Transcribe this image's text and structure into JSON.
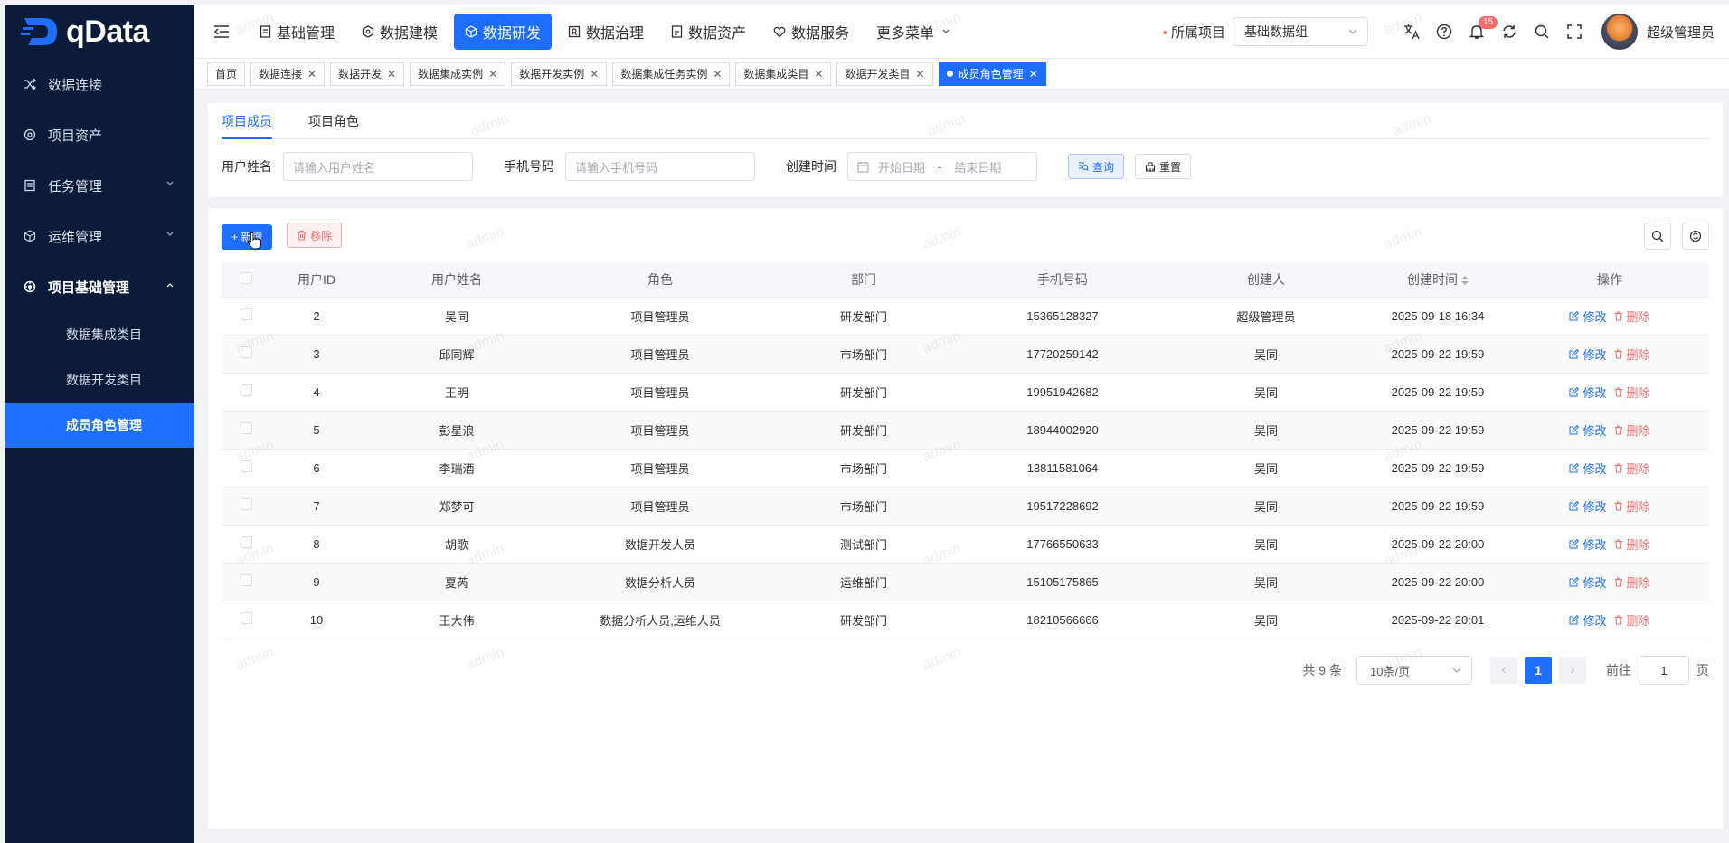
{
  "brand": {
    "name": "qData"
  },
  "sidebar": {
    "items": [
      {
        "label": "数据连接",
        "icon": "shuffle-icon"
      },
      {
        "label": "项目资产",
        "icon": "asset-icon"
      },
      {
        "label": "任务管理",
        "icon": "task-icon",
        "has_children": true
      },
      {
        "label": "运维管理",
        "icon": "cube-icon",
        "has_children": true
      },
      {
        "label": "项目基础管理",
        "icon": "gear-icon",
        "expanded": true
      }
    ],
    "subitems": [
      {
        "label": "数据集成类目"
      },
      {
        "label": "数据开发类目"
      },
      {
        "label": "成员角色管理",
        "active": true
      }
    ]
  },
  "topnav": {
    "items": [
      {
        "label": "基础管理",
        "icon": "doc-icon"
      },
      {
        "label": "数据建模",
        "icon": "model-icon"
      },
      {
        "label": "数据研发",
        "icon": "dev-icon",
        "active": true
      },
      {
        "label": "数据治理",
        "icon": "govern-icon"
      },
      {
        "label": "数据资产",
        "icon": "asset-icon"
      },
      {
        "label": "数据服务",
        "icon": "service-icon"
      },
      {
        "label": "更多菜单",
        "icon": "chevron-down-icon"
      }
    ]
  },
  "header": {
    "project_label": "所属项目",
    "project_value": "基础数据组",
    "notification_count": "15",
    "username": "超级管理员"
  },
  "tags": [
    {
      "label": "首页",
      "closable": false
    },
    {
      "label": "数据连接",
      "closable": true
    },
    {
      "label": "数据开发",
      "closable": true
    },
    {
      "label": "数据集成实例",
      "closable": true
    },
    {
      "label": "数据开发实例",
      "closable": true
    },
    {
      "label": "数据集成任务实例",
      "closable": true
    },
    {
      "label": "数据集成类目",
      "closable": true
    },
    {
      "label": "数据开发类目",
      "closable": true
    },
    {
      "label": "成员角色管理",
      "closable": true,
      "active": true
    }
  ],
  "tabs": [
    {
      "label": "项目成员",
      "active": true
    },
    {
      "label": "项目角色",
      "active": false
    }
  ],
  "search": {
    "username_label": "用户姓名",
    "username_placeholder": "请输入用户姓名",
    "phone_label": "手机号码",
    "phone_placeholder": "请输入手机号码",
    "date_label": "创建时间",
    "date_start_placeholder": "开始日期",
    "date_sep": "-",
    "date_end_placeholder": "结束日期",
    "query_label": "查询",
    "reset_label": "重置"
  },
  "toolbar": {
    "add_label": "+ 新增",
    "remove_label": "移除"
  },
  "table": {
    "columns": [
      "用户ID",
      "用户姓名",
      "角色",
      "部门",
      "手机号码",
      "创建人",
      "创建时间",
      "操作"
    ],
    "edit_label": "修改",
    "delete_label": "删除",
    "rows": [
      {
        "id": "2",
        "name": "吴同",
        "role": "项目管理员",
        "dept": "研发部门",
        "phone": "15365128327",
        "creator": "超级管理员",
        "time": "2025-09-18 16:34"
      },
      {
        "id": "3",
        "name": "邱同辉",
        "role": "项目管理员",
        "dept": "市场部门",
        "phone": "17720259142",
        "creator": "吴同",
        "time": "2025-09-22 19:59"
      },
      {
        "id": "4",
        "name": "王明",
        "role": "项目管理员",
        "dept": "研发部门",
        "phone": "19951942682",
        "creator": "吴同",
        "time": "2025-09-22 19:59"
      },
      {
        "id": "5",
        "name": "彭星浪",
        "role": "项目管理员",
        "dept": "研发部门",
        "phone": "18944002920",
        "creator": "吴同",
        "time": "2025-09-22 19:59"
      },
      {
        "id": "6",
        "name": "李瑞酒",
        "role": "项目管理员",
        "dept": "市场部门",
        "phone": "13811581064",
        "creator": "吴同",
        "time": "2025-09-22 19:59"
      },
      {
        "id": "7",
        "name": "郑梦可",
        "role": "项目管理员",
        "dept": "市场部门",
        "phone": "19517228692",
        "creator": "吴同",
        "time": "2025-09-22 19:59"
      },
      {
        "id": "8",
        "name": "胡歌",
        "role": "数据开发人员",
        "dept": "测试部门",
        "phone": "17766550633",
        "creator": "吴同",
        "time": "2025-09-22 20:00"
      },
      {
        "id": "9",
        "name": "夏芮",
        "role": "数据分析人员",
        "dept": "运维部门",
        "phone": "15105175865",
        "creator": "吴同",
        "time": "2025-09-22 20:00"
      },
      {
        "id": "10",
        "name": "王大伟",
        "role": "数据分析人员,运维人员",
        "dept": "研发部门",
        "phone": "18210566666",
        "creator": "吴同",
        "time": "2025-09-22 20:01"
      }
    ]
  },
  "pager": {
    "total": "共 9 条",
    "page_size": "10条/页",
    "current": "1",
    "goto_label": "前往",
    "goto_value": "1",
    "page_suffix": "页"
  },
  "watermark": "admin",
  "colors": {
    "primary": "#1e6eff",
    "sidebar": "#0c1b3a",
    "danger": "#f56c6c"
  }
}
